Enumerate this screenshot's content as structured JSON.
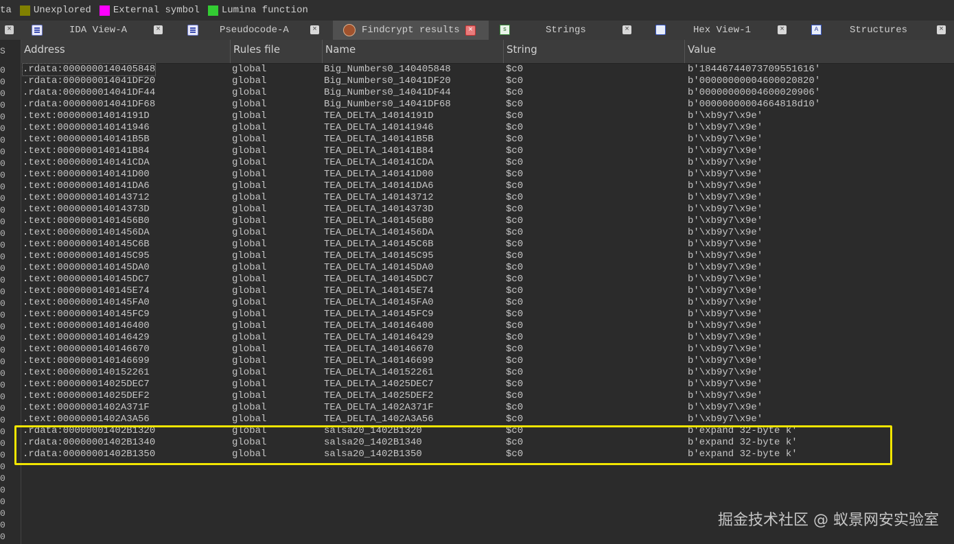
{
  "legend": [
    {
      "label": "ta",
      "color": ""
    },
    {
      "label": "Unexplored",
      "color": "#808000"
    },
    {
      "label": "External symbol",
      "color": "#ff00ff"
    },
    {
      "label": "Lumina function",
      "color": "#33cc33"
    }
  ],
  "tabs": [
    {
      "label": "IDA View-A",
      "icon": "ida-view-icon",
      "active": false
    },
    {
      "label": "Pseudocode-A",
      "icon": "pseudocode-icon",
      "active": false
    },
    {
      "label": "Findcrypt results",
      "icon": "findcrypt-icon",
      "active": true
    },
    {
      "label": "Strings",
      "icon": "strings-icon",
      "active": false
    },
    {
      "label": "Hex View-1",
      "icon": "hex-view-icon",
      "active": false
    },
    {
      "label": "Structures",
      "icon": "structures-icon",
      "active": false
    }
  ],
  "columns": [
    "Address",
    "Rules file",
    "Name",
    "String",
    "Value"
  ],
  "rows": [
    [
      ".rdata:0000000140405848",
      "global",
      "Big_Numbers0_140405848",
      "$c0",
      "b'18446744073709551616'"
    ],
    [
      ".rdata:000000014041DF20",
      "global",
      "Big_Numbers0_14041DF20",
      "$c0",
      "b'00000000004600020820'"
    ],
    [
      ".rdata:000000014041DF44",
      "global",
      "Big_Numbers0_14041DF44",
      "$c0",
      "b'00000000004600020906'"
    ],
    [
      ".rdata:000000014041DF68",
      "global",
      "Big_Numbers0_14041DF68",
      "$c0",
      "b'00000000004664818d10'"
    ],
    [
      ".text:000000014014191D",
      "global",
      "TEA_DELTA_14014191D",
      "$c0",
      "b'\\xb9y7\\x9e'"
    ],
    [
      ".text:0000000140141946",
      "global",
      "TEA_DELTA_140141946",
      "$c0",
      "b'\\xb9y7\\x9e'"
    ],
    [
      ".text:0000000140141B5B",
      "global",
      "TEA_DELTA_140141B5B",
      "$c0",
      "b'\\xb9y7\\x9e'"
    ],
    [
      ".text:0000000140141B84",
      "global",
      "TEA_DELTA_140141B84",
      "$c0",
      "b'\\xb9y7\\x9e'"
    ],
    [
      ".text:0000000140141CDA",
      "global",
      "TEA_DELTA_140141CDA",
      "$c0",
      "b'\\xb9y7\\x9e'"
    ],
    [
      ".text:0000000140141D00",
      "global",
      "TEA_DELTA_140141D00",
      "$c0",
      "b'\\xb9y7\\x9e'"
    ],
    [
      ".text:0000000140141DA6",
      "global",
      "TEA_DELTA_140141DA6",
      "$c0",
      "b'\\xb9y7\\x9e'"
    ],
    [
      ".text:0000000140143712",
      "global",
      "TEA_DELTA_140143712",
      "$c0",
      "b'\\xb9y7\\x9e'"
    ],
    [
      ".text:000000014014373D",
      "global",
      "TEA_DELTA_14014373D",
      "$c0",
      "b'\\xb9y7\\x9e'"
    ],
    [
      ".text:00000001401456B0",
      "global",
      "TEA_DELTA_1401456B0",
      "$c0",
      "b'\\xb9y7\\x9e'"
    ],
    [
      ".text:00000001401456DA",
      "global",
      "TEA_DELTA_1401456DA",
      "$c0",
      "b'\\xb9y7\\x9e'"
    ],
    [
      ".text:0000000140145C6B",
      "global",
      "TEA_DELTA_140145C6B",
      "$c0",
      "b'\\xb9y7\\x9e'"
    ],
    [
      ".text:0000000140145C95",
      "global",
      "TEA_DELTA_140145C95",
      "$c0",
      "b'\\xb9y7\\x9e'"
    ],
    [
      ".text:0000000140145DA0",
      "global",
      "TEA_DELTA_140145DA0",
      "$c0",
      "b'\\xb9y7\\x9e'"
    ],
    [
      ".text:0000000140145DC7",
      "global",
      "TEA_DELTA_140145DC7",
      "$c0",
      "b'\\xb9y7\\x9e'"
    ],
    [
      ".text:0000000140145E74",
      "global",
      "TEA_DELTA_140145E74",
      "$c0",
      "b'\\xb9y7\\x9e'"
    ],
    [
      ".text:0000000140145FA0",
      "global",
      "TEA_DELTA_140145FA0",
      "$c0",
      "b'\\xb9y7\\x9e'"
    ],
    [
      ".text:0000000140145FC9",
      "global",
      "TEA_DELTA_140145FC9",
      "$c0",
      "b'\\xb9y7\\x9e'"
    ],
    [
      ".text:0000000140146400",
      "global",
      "TEA_DELTA_140146400",
      "$c0",
      "b'\\xb9y7\\x9e'"
    ],
    [
      ".text:0000000140146429",
      "global",
      "TEA_DELTA_140146429",
      "$c0",
      "b'\\xb9y7\\x9e'"
    ],
    [
      ".text:0000000140146670",
      "global",
      "TEA_DELTA_140146670",
      "$c0",
      "b'\\xb9y7\\x9e'"
    ],
    [
      ".text:0000000140146699",
      "global",
      "TEA_DELTA_140146699",
      "$c0",
      "b'\\xb9y7\\x9e'"
    ],
    [
      ".text:0000000140152261",
      "global",
      "TEA_DELTA_140152261",
      "$c0",
      "b'\\xb9y7\\x9e'"
    ],
    [
      ".text:000000014025DEC7",
      "global",
      "TEA_DELTA_14025DEC7",
      "$c0",
      "b'\\xb9y7\\x9e'"
    ],
    [
      ".text:000000014025DEF2",
      "global",
      "TEA_DELTA_14025DEF2",
      "$c0",
      "b'\\xb9y7\\x9e'"
    ],
    [
      ".text:00000001402A371F",
      "global",
      "TEA_DELTA_1402A371F",
      "$c0",
      "b'\\xb9y7\\x9e'"
    ],
    [
      ".text:00000001402A3A56",
      "global",
      "TEA_DELTA_1402A3A56",
      "$c0",
      "b'\\xb9y7\\x9e'"
    ],
    [
      ".rdata:00000001402B1320",
      "global",
      "salsa20_1402B1320",
      "$c0",
      "b'expand 32-byte k'"
    ],
    [
      ".rdata:00000001402B1340",
      "global",
      "salsa20_1402B1340",
      "$c0",
      "b'expand 32-byte k'"
    ],
    [
      ".rdata:00000001402B1350",
      "global",
      "salsa20_1402B1350",
      "$c0",
      "b'expand 32-byte k'"
    ]
  ],
  "gutter": {
    "header": "S",
    "zero": "0",
    "close": "×"
  },
  "highlight_color": "#f2e600",
  "watermark": "掘金技术社区 @ 蚁景网安实验室"
}
